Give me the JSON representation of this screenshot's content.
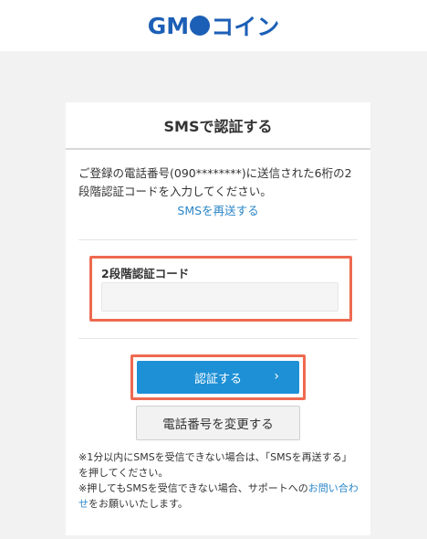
{
  "header": {
    "logo_text_1": "GM",
    "logo_text_2": "コイン"
  },
  "card": {
    "title": "SMSで認証する",
    "description": "ご登録の電話番号(090********)に送信された6桁の2段階認証コードを入力してください。",
    "resend_link": "SMSを再送する",
    "code_field": {
      "label": "2段階認証コード",
      "value": "",
      "placeholder": ""
    },
    "submit_label": "認証する",
    "change_phone_label": "電話番号を変更する",
    "note_1": "※1分以内にSMSを受信できない場合は、「SMSを再送する」を押してください。",
    "note_2_before": "※押してもSMSを受信できない場合、サポートへの",
    "note_2_link": "お問い合わせ",
    "note_2_after": "をお願いいたします。"
  },
  "colors": {
    "brand": "#1c5fb6",
    "primary_button": "#1e90d6",
    "link": "#2a86c8",
    "highlight_border": "#ee6a50"
  }
}
